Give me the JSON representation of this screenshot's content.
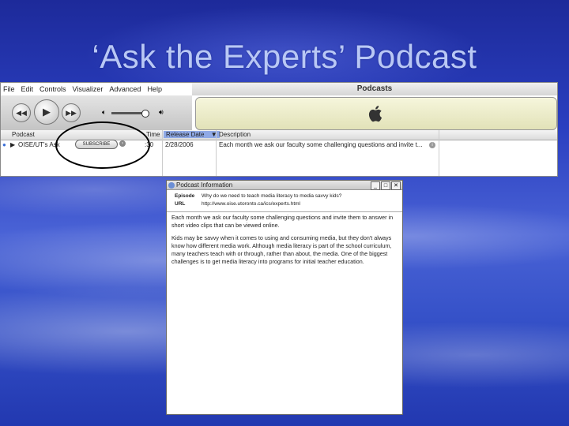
{
  "slide": {
    "title": "‘Ask the Experts’ Podcast"
  },
  "itunes": {
    "menu": [
      "File",
      "Edit",
      "Controls",
      "Visualizer",
      "Advanced",
      "Help"
    ],
    "window_title": "Podcasts",
    "columns": {
      "podcast": "Podcast",
      "time": "Time",
      "release_date": "Release Date",
      "description": "Description"
    },
    "row": {
      "podcast": "OISE/UT's Ask",
      "subscribe": "SUBSCRIBE",
      "time": ":30",
      "release_date": "2/28/2006",
      "description": "Each month we ask our faculty some challenging questions and invite t..."
    }
  },
  "dialog": {
    "title": "Podcast Information",
    "episode_label": "Episode",
    "episode_value": "Why do we need to teach media literacy to media savvy kids?",
    "url_label": "URL",
    "url_value": "http://www.oise.utoronto.ca/ics/experts.html",
    "paragraph1": "Each month we ask our faculty some challenging questions and invite them to answer in short video clips that can be viewed online.",
    "paragraph2": "Kids may be savvy when it comes to using and consuming media, but they don't always know how different media work. Although media literacy is part of the school curriculum, many teachers teach with or through, rather than about, the media. One of the biggest challenges is to get media literacy into programs for initial teacher education."
  }
}
